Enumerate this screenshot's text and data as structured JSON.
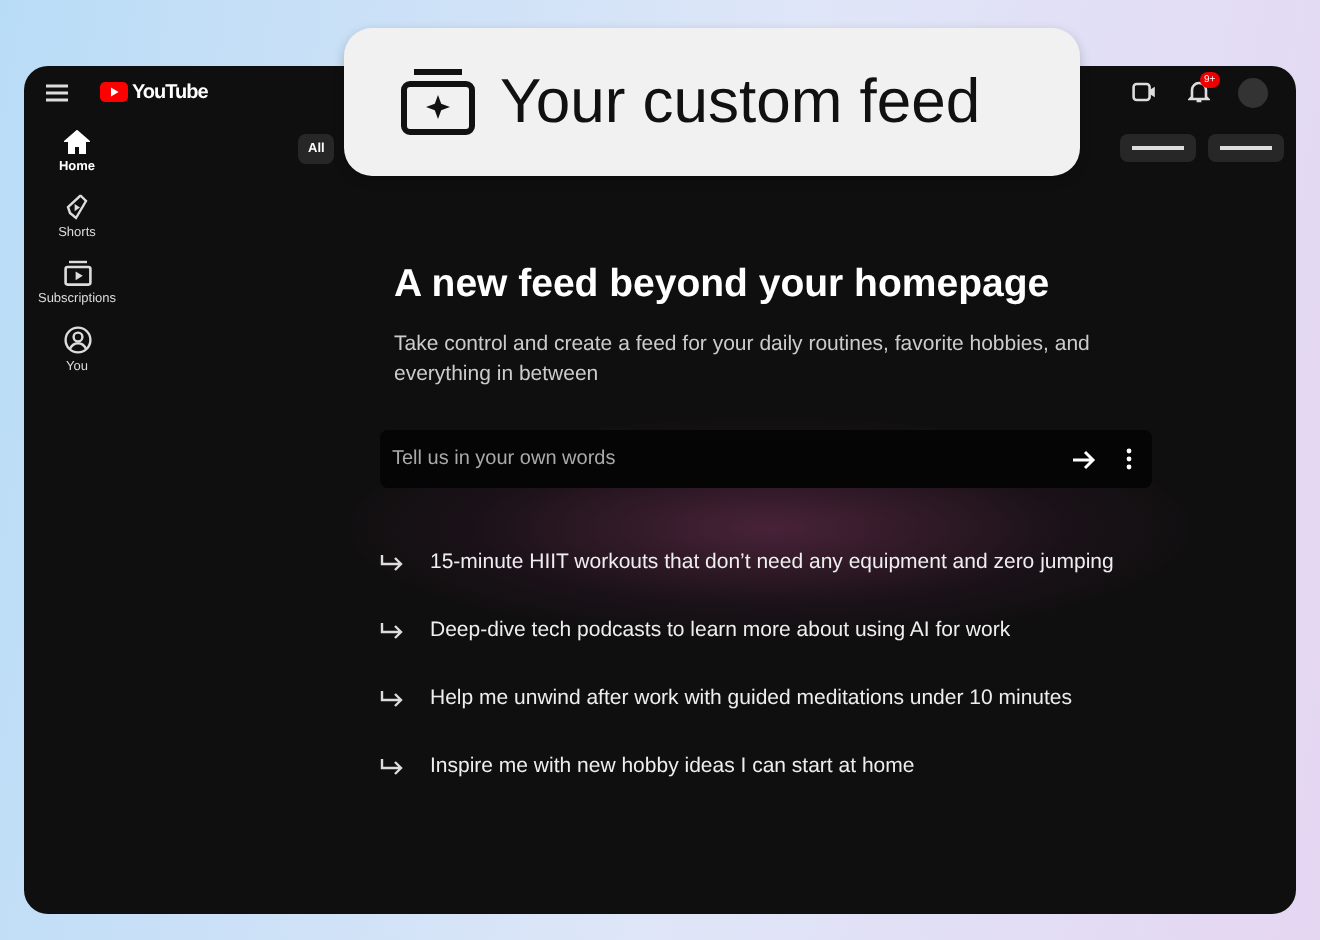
{
  "header": {
    "logo_text": "YouTube",
    "notification_badge": "9+"
  },
  "sidebar": {
    "items": [
      {
        "label": "Home",
        "kind": "home",
        "selected": true
      },
      {
        "label": "Shorts",
        "kind": "shorts",
        "selected": false
      },
      {
        "label": "Subscriptions",
        "kind": "subscriptions",
        "selected": false
      },
      {
        "label": "You",
        "kind": "you",
        "selected": false
      }
    ]
  },
  "chips": [
    {
      "label": "All"
    }
  ],
  "callout": {
    "title": "Your custom feed"
  },
  "feed": {
    "heading": "A new feed beyond your homepage",
    "description": "Take control and create a feed for your daily routines, favorite hobbies, and everything in between",
    "search": {
      "placeholder": "Tell us in your own words"
    },
    "suggestions": [
      "15-minute HIIT workouts that don’t need any equipment and zero jumping",
      "Deep-dive tech podcasts to learn more about using AI for work",
      "Help me unwind after work with guided meditations under 10 minutes",
      "Inspire me with new hobby ideas I can start at home"
    ]
  }
}
